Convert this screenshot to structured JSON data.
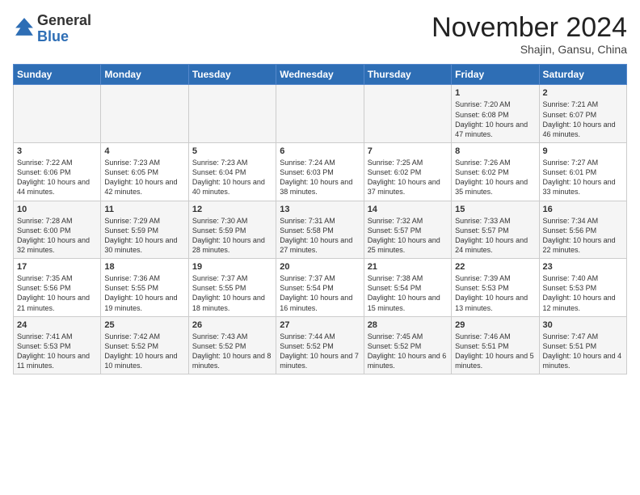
{
  "header": {
    "logo_general": "General",
    "logo_blue": "Blue",
    "month_title": "November 2024",
    "location": "Shajin, Gansu, China"
  },
  "days_of_week": [
    "Sunday",
    "Monday",
    "Tuesday",
    "Wednesday",
    "Thursday",
    "Friday",
    "Saturday"
  ],
  "weeks": [
    [
      {
        "num": "",
        "info": ""
      },
      {
        "num": "",
        "info": ""
      },
      {
        "num": "",
        "info": ""
      },
      {
        "num": "",
        "info": ""
      },
      {
        "num": "",
        "info": ""
      },
      {
        "num": "1",
        "info": "Sunrise: 7:20 AM\nSunset: 6:08 PM\nDaylight: 10 hours and 47 minutes."
      },
      {
        "num": "2",
        "info": "Sunrise: 7:21 AM\nSunset: 6:07 PM\nDaylight: 10 hours and 46 minutes."
      }
    ],
    [
      {
        "num": "3",
        "info": "Sunrise: 7:22 AM\nSunset: 6:06 PM\nDaylight: 10 hours and 44 minutes."
      },
      {
        "num": "4",
        "info": "Sunrise: 7:23 AM\nSunset: 6:05 PM\nDaylight: 10 hours and 42 minutes."
      },
      {
        "num": "5",
        "info": "Sunrise: 7:23 AM\nSunset: 6:04 PM\nDaylight: 10 hours and 40 minutes."
      },
      {
        "num": "6",
        "info": "Sunrise: 7:24 AM\nSunset: 6:03 PM\nDaylight: 10 hours and 38 minutes."
      },
      {
        "num": "7",
        "info": "Sunrise: 7:25 AM\nSunset: 6:02 PM\nDaylight: 10 hours and 37 minutes."
      },
      {
        "num": "8",
        "info": "Sunrise: 7:26 AM\nSunset: 6:02 PM\nDaylight: 10 hours and 35 minutes."
      },
      {
        "num": "9",
        "info": "Sunrise: 7:27 AM\nSunset: 6:01 PM\nDaylight: 10 hours and 33 minutes."
      }
    ],
    [
      {
        "num": "10",
        "info": "Sunrise: 7:28 AM\nSunset: 6:00 PM\nDaylight: 10 hours and 32 minutes."
      },
      {
        "num": "11",
        "info": "Sunrise: 7:29 AM\nSunset: 5:59 PM\nDaylight: 10 hours and 30 minutes."
      },
      {
        "num": "12",
        "info": "Sunrise: 7:30 AM\nSunset: 5:59 PM\nDaylight: 10 hours and 28 minutes."
      },
      {
        "num": "13",
        "info": "Sunrise: 7:31 AM\nSunset: 5:58 PM\nDaylight: 10 hours and 27 minutes."
      },
      {
        "num": "14",
        "info": "Sunrise: 7:32 AM\nSunset: 5:57 PM\nDaylight: 10 hours and 25 minutes."
      },
      {
        "num": "15",
        "info": "Sunrise: 7:33 AM\nSunset: 5:57 PM\nDaylight: 10 hours and 24 minutes."
      },
      {
        "num": "16",
        "info": "Sunrise: 7:34 AM\nSunset: 5:56 PM\nDaylight: 10 hours and 22 minutes."
      }
    ],
    [
      {
        "num": "17",
        "info": "Sunrise: 7:35 AM\nSunset: 5:56 PM\nDaylight: 10 hours and 21 minutes."
      },
      {
        "num": "18",
        "info": "Sunrise: 7:36 AM\nSunset: 5:55 PM\nDaylight: 10 hours and 19 minutes."
      },
      {
        "num": "19",
        "info": "Sunrise: 7:37 AM\nSunset: 5:55 PM\nDaylight: 10 hours and 18 minutes."
      },
      {
        "num": "20",
        "info": "Sunrise: 7:37 AM\nSunset: 5:54 PM\nDaylight: 10 hours and 16 minutes."
      },
      {
        "num": "21",
        "info": "Sunrise: 7:38 AM\nSunset: 5:54 PM\nDaylight: 10 hours and 15 minutes."
      },
      {
        "num": "22",
        "info": "Sunrise: 7:39 AM\nSunset: 5:53 PM\nDaylight: 10 hours and 13 minutes."
      },
      {
        "num": "23",
        "info": "Sunrise: 7:40 AM\nSunset: 5:53 PM\nDaylight: 10 hours and 12 minutes."
      }
    ],
    [
      {
        "num": "24",
        "info": "Sunrise: 7:41 AM\nSunset: 5:53 PM\nDaylight: 10 hours and 11 minutes."
      },
      {
        "num": "25",
        "info": "Sunrise: 7:42 AM\nSunset: 5:52 PM\nDaylight: 10 hours and 10 minutes."
      },
      {
        "num": "26",
        "info": "Sunrise: 7:43 AM\nSunset: 5:52 PM\nDaylight: 10 hours and 8 minutes."
      },
      {
        "num": "27",
        "info": "Sunrise: 7:44 AM\nSunset: 5:52 PM\nDaylight: 10 hours and 7 minutes."
      },
      {
        "num": "28",
        "info": "Sunrise: 7:45 AM\nSunset: 5:52 PM\nDaylight: 10 hours and 6 minutes."
      },
      {
        "num": "29",
        "info": "Sunrise: 7:46 AM\nSunset: 5:51 PM\nDaylight: 10 hours and 5 minutes."
      },
      {
        "num": "30",
        "info": "Sunrise: 7:47 AM\nSunset: 5:51 PM\nDaylight: 10 hours and 4 minutes."
      }
    ]
  ]
}
